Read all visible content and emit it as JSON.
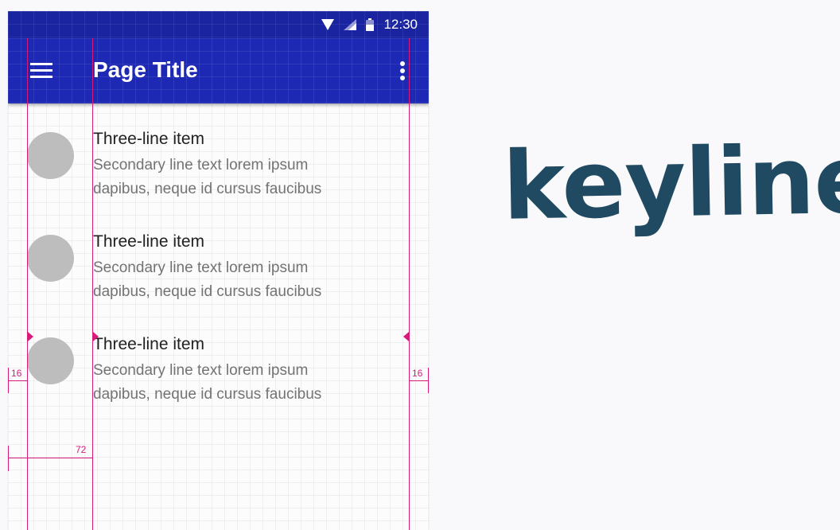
{
  "status_bar": {
    "time": "12:30",
    "icons": [
      "wifi-icon",
      "signal-icon",
      "battery-icon"
    ]
  },
  "app_bar": {
    "title": "Page Title",
    "nav_icon": "menu-icon",
    "action_icon": "overflow-icon"
  },
  "list": {
    "items": [
      {
        "primary": "Three-line item",
        "secondary": "Secondary line text lorem ipsum dapibus, neque id cursus faucibus"
      },
      {
        "primary": "Three-line item",
        "secondary": "Secondary line text lorem ipsum dapibus, neque id cursus faucibus"
      },
      {
        "primary": "Three-line item",
        "secondary": "Secondary line text lorem ipsum dapibus, neque id cursus faucibus"
      }
    ]
  },
  "keylines": {
    "margin_left": "16",
    "margin_right": "16",
    "content_inset": "72"
  },
  "headline": "keylines",
  "colors": {
    "status_bar": "#1a23a0",
    "app_bar": "#1d28b5",
    "keyline": "#d81b7a",
    "avatar": "#bdbdbd",
    "headline": "#1f4a61"
  }
}
